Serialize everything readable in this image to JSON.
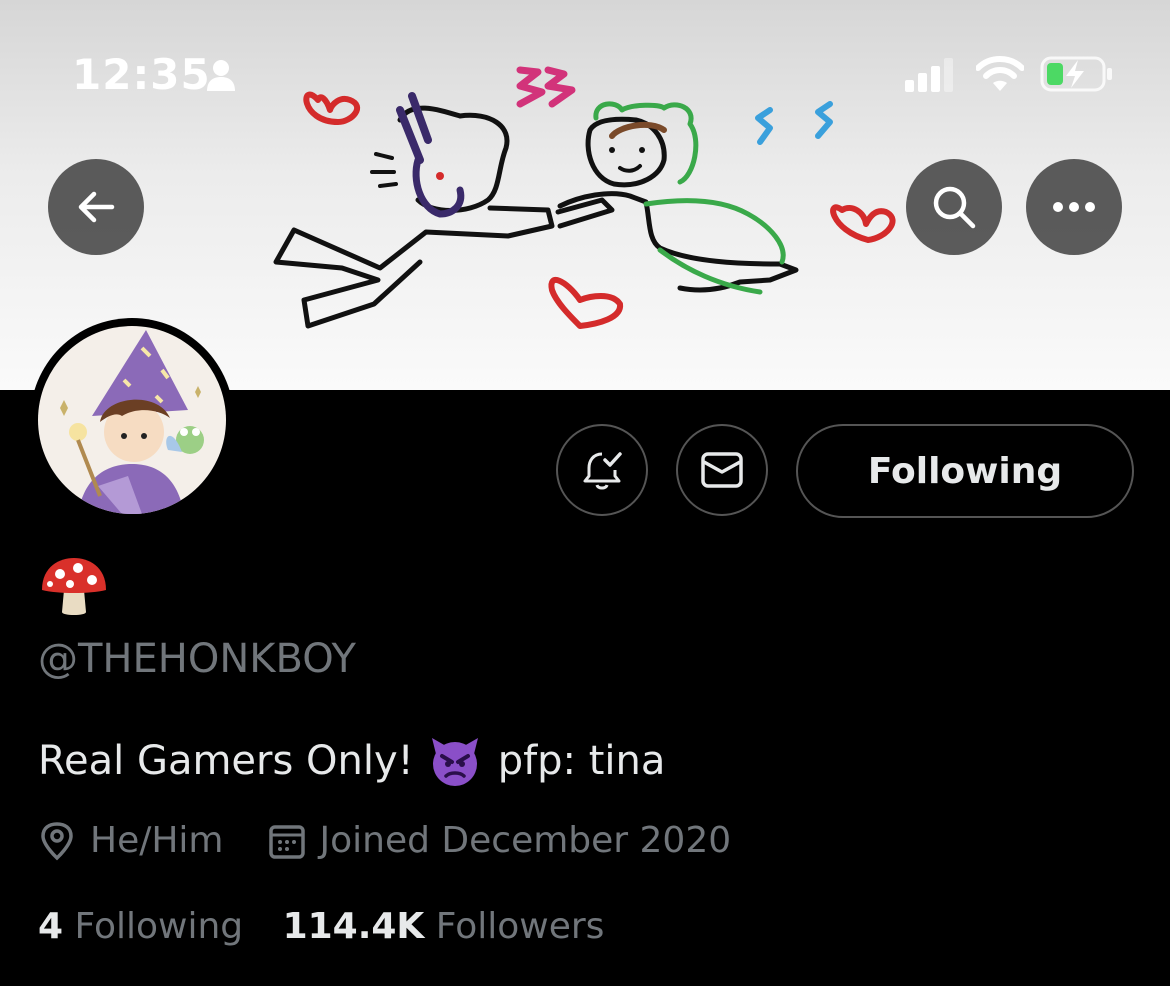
{
  "status_bar": {
    "time": "12:35"
  },
  "header": {
    "back_icon": "arrow-left-icon",
    "search_icon": "search-icon",
    "more_icon": "more-horizontal-icon"
  },
  "profile": {
    "display_name_emoji": "mushroom",
    "handle": "@THEHONKBOY",
    "bio_start": "Real Gamers Only!",
    "bio_emoji": "angry-devil",
    "bio_end": "pfp: tina",
    "pronouns": "He/Him",
    "joined": "Joined December 2020",
    "following_count": "4",
    "following_label": "Following",
    "followers_count": "114.4K",
    "followers_label": "Followers"
  },
  "actions": {
    "follow_label": "Following"
  },
  "colors": {
    "background": "#000000",
    "muted_text": "#71767b",
    "primary_text": "#e7e9ea",
    "button_border": "#555555"
  }
}
